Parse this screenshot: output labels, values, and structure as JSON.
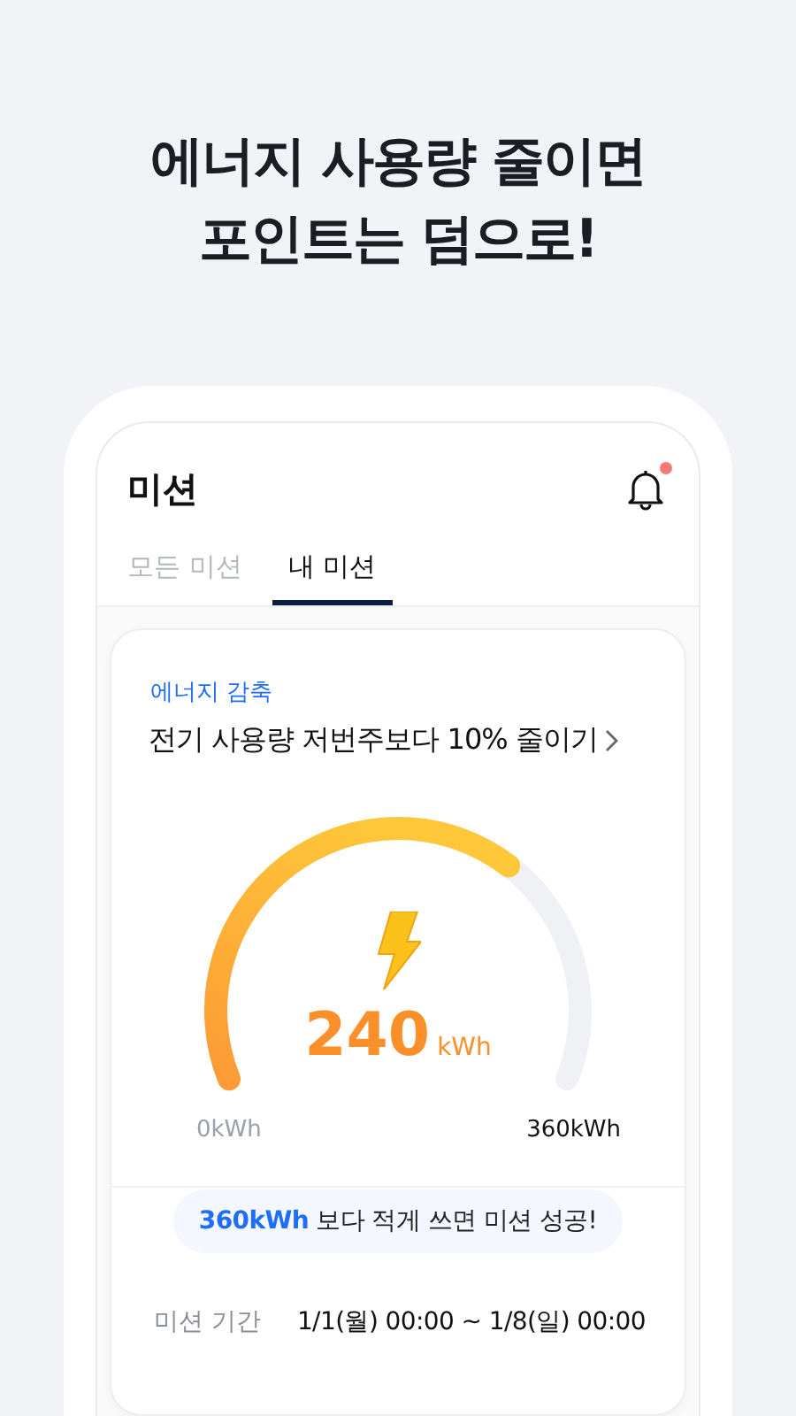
{
  "headline": [
    "에너지 사용량 줄이면",
    "포인트는 덤으로!"
  ],
  "screen": {
    "title": "미션",
    "notification_unread": true,
    "tabs": [
      {
        "label": "모든 미션",
        "selected": false
      },
      {
        "label": "내 미션",
        "selected": true
      }
    ],
    "mission": {
      "category": "에너지 감축",
      "title": "전기 사용량 저번주보다 10% 줄이기",
      "gauge": {
        "value": "240",
        "unit": "kWh",
        "min_label": "0kWh",
        "max_label": "360kWh"
      },
      "note": "**360kWh** 보다 적게 쓰면 미션 성공!",
      "period_label": "미션 기간",
      "period": "1/1(월) 00:00 ~ 1/8(일) 00:00"
    }
  }
}
